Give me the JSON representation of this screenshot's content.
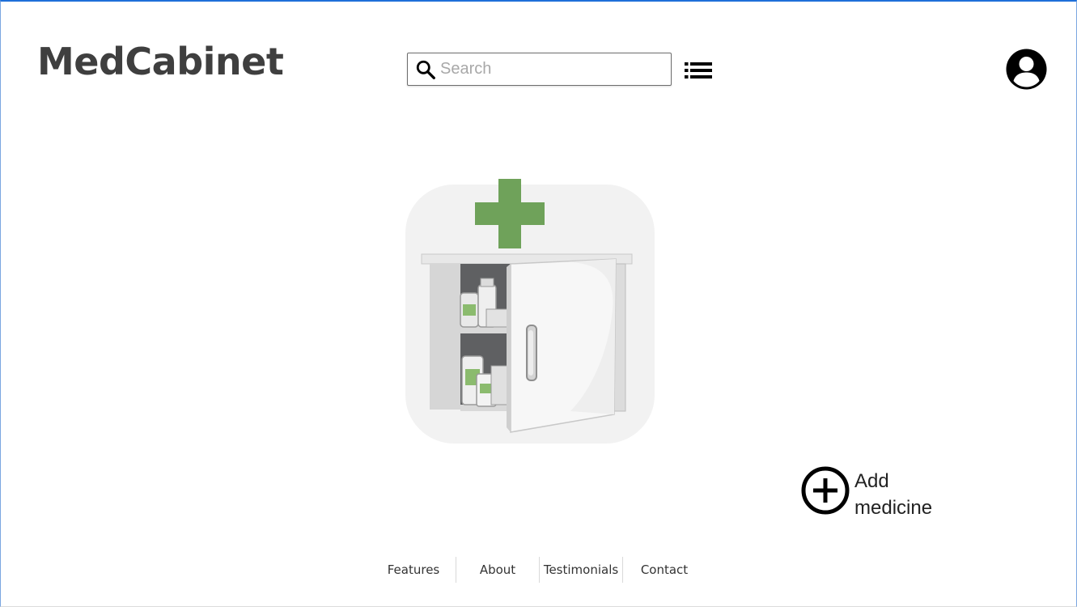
{
  "header": {
    "logo": "MedCabinet",
    "search": {
      "placeholder": "Search",
      "value": ""
    },
    "icons": {
      "search": "search-icon",
      "list": "list-icon",
      "account": "account-circle-icon"
    }
  },
  "main": {
    "hero_image": "medicine-cabinet-illustration",
    "add_medicine": {
      "icon": "add-circle-icon",
      "label_line1": "Add",
      "label_line2": "medicine"
    }
  },
  "footer": {
    "links": [
      {
        "label": "Features"
      },
      {
        "label": "About"
      },
      {
        "label": "Testimonials"
      },
      {
        "label": "Contact"
      }
    ]
  },
  "colors": {
    "logo_text": "#3f3f3f",
    "accent_green": "#6fa25a",
    "frame_border": "#1e6fd9"
  }
}
